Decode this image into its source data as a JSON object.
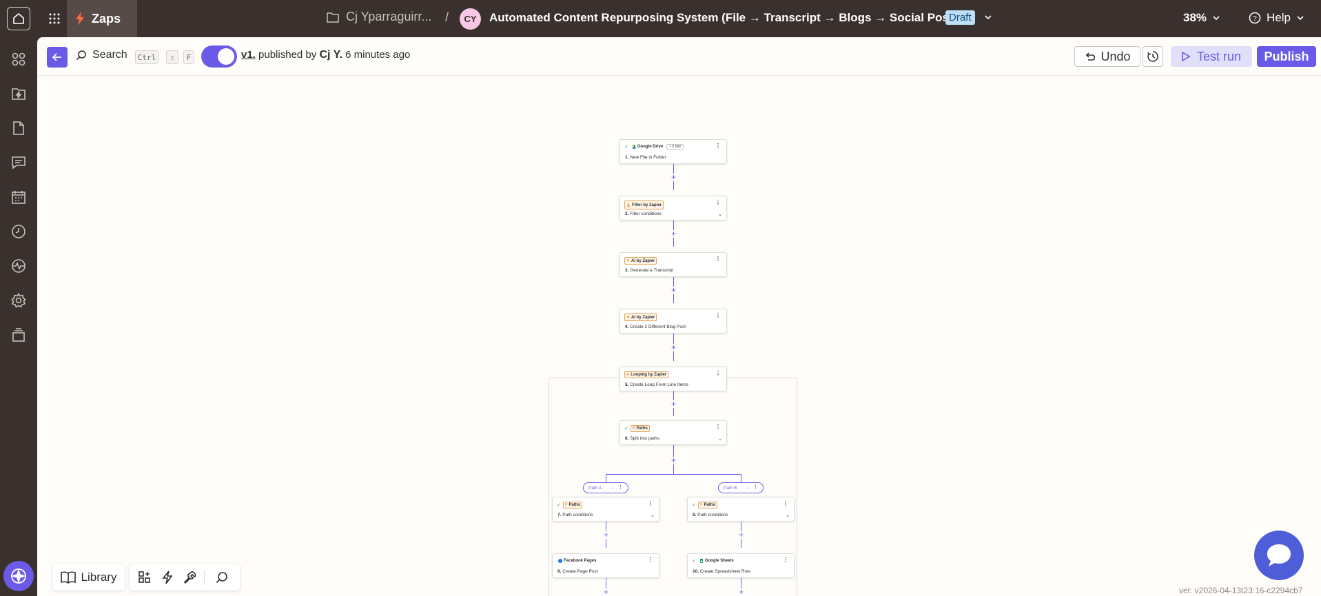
{
  "topbar": {
    "zaps_label": "Zaps",
    "folder_name": "Cj Yparraguirr...",
    "separator": "/",
    "owner_initials": "CY",
    "zap_title": "Automated Content Repurposing System (File → Transcript → Blogs → Social Posts)",
    "status_badge": "Draft",
    "zoom": "38%",
    "help_label": "Help"
  },
  "toolbar": {
    "search_label": "Search",
    "shortcut_keys": [
      "Ctrl",
      "⇧",
      "F"
    ],
    "version": "v1.",
    "published_by_text": "published by",
    "publisher": "Cj Y.",
    "published_ago": "6 minutes ago",
    "undo_label": "Undo",
    "test_run_label": "Test run",
    "publish_label": "Publish"
  },
  "steps": [
    {
      "app": "Google Drive",
      "num": "1.",
      "title": "New File in Folder",
      "checked": true,
      "time": "2 min",
      "outlined": false,
      "chevron": false
    },
    {
      "app": "Filter by Zapier",
      "num": "2.",
      "title": "Filter conditions",
      "checked": false,
      "outlined": true,
      "chevron": true
    },
    {
      "app": "AI by Zapier",
      "num": "3.",
      "title": "Generate a Transcript",
      "checked": false,
      "outlined": true,
      "chevron": false
    },
    {
      "app": "AI by Zapier",
      "num": "4.",
      "title": "Create 2 Different Blog Post",
      "checked": false,
      "outlined": true,
      "chevron": false
    },
    {
      "app": "Looping by Zapier",
      "num": "5.",
      "title": "Create Loop From Line Items",
      "checked": false,
      "outlined": true,
      "chevron": false
    },
    {
      "app": "Paths",
      "num": "6.",
      "title": "Split into paths",
      "checked": true,
      "outlined": true,
      "chevron": true
    },
    {
      "app": "Paths",
      "num": "7.",
      "title": "Path conditions",
      "checked": true,
      "outlined": true,
      "chevron": true
    },
    {
      "app": "Facebook Pages",
      "num": "8.",
      "title": "Create Page Post",
      "checked": false,
      "outlined": false,
      "chevron": false
    },
    {
      "app": "Paths",
      "num": "9.",
      "title": "Path conditions",
      "checked": true,
      "outlined": true,
      "chevron": true
    },
    {
      "app": "Google Sheets",
      "num": "10.",
      "title": "Create Spreadsheet Row",
      "checked": true,
      "outlined": false,
      "chevron": false
    }
  ],
  "paths": [
    {
      "label": "Path A"
    },
    {
      "label": "Path B"
    }
  ],
  "bottom": {
    "library_label": "Library",
    "version_text": "ver. v2026-04-13t23:16-c2294cb7"
  },
  "colors": {
    "accent": "#695be8",
    "chrome": "#3a302d",
    "draft_badge": "#bde0f8",
    "canvas": "#fffdf9",
    "chat": "#4e5ed8"
  }
}
